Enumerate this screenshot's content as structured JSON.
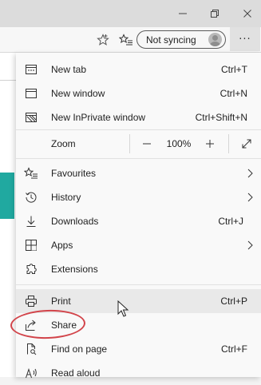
{
  "window": {
    "minimize_icon": "minimize-icon",
    "maximize_icon": "restore-icon",
    "close_icon": "close-icon"
  },
  "toolbar": {
    "favorite_icon": "star-outline-icon",
    "collections_icon": "favorites-list-icon",
    "sync_label": "Not syncing",
    "more_label": "···"
  },
  "menu": {
    "items": [
      {
        "label": "New tab",
        "shortcut": "Ctrl+T",
        "icon": "new-tab-icon"
      },
      {
        "label": "New window",
        "shortcut": "Ctrl+N",
        "icon": "new-window-icon"
      },
      {
        "label": "New InPrivate window",
        "shortcut": "Ctrl+Shift+N",
        "icon": "inprivate-icon"
      }
    ],
    "zoom": {
      "label": "Zoom",
      "minus": "—",
      "value": "100%",
      "plus": "+"
    },
    "items2": [
      {
        "label": "Favourites",
        "icon": "favourites-icon",
        "has_submenu": true
      },
      {
        "label": "History",
        "icon": "history-icon",
        "has_submenu": true
      },
      {
        "label": "Downloads",
        "shortcut": "Ctrl+J",
        "icon": "download-icon"
      },
      {
        "label": "Apps",
        "icon": "apps-icon",
        "has_submenu": true
      },
      {
        "label": "Extensions",
        "icon": "extensions-icon"
      }
    ],
    "items3": [
      {
        "label": "Print",
        "shortcut": "Ctrl+P",
        "icon": "print-icon",
        "highlighted": true
      },
      {
        "label": "Share",
        "icon": "share-icon"
      },
      {
        "label": "Find on page",
        "shortcut": "Ctrl+F",
        "icon": "find-on-page-icon"
      },
      {
        "label": "Read aloud",
        "icon": "read-aloud-icon"
      }
    ]
  },
  "colors": {
    "annotation": "#d2444a",
    "accent_teal": "#20a9a0"
  }
}
